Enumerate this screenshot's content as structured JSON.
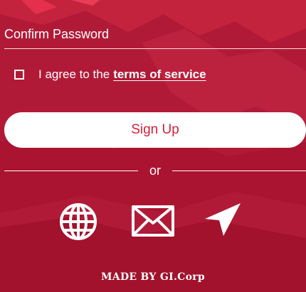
{
  "form": {
    "confirm_password_placeholder": "Confirm Password",
    "agree_text": "I agree to the",
    "terms_link": "terms of service",
    "signup_label": "Sign Up",
    "divider_text": "or"
  },
  "social": [
    {
      "icon": "globe-icon"
    },
    {
      "icon": "mail-icon"
    },
    {
      "icon": "send-icon"
    }
  ],
  "footer": {
    "text": "MADE BY GI.Corp"
  },
  "colors": {
    "background": "#b11a37",
    "button_bg": "#ffffff",
    "button_text": "#d4203a"
  }
}
